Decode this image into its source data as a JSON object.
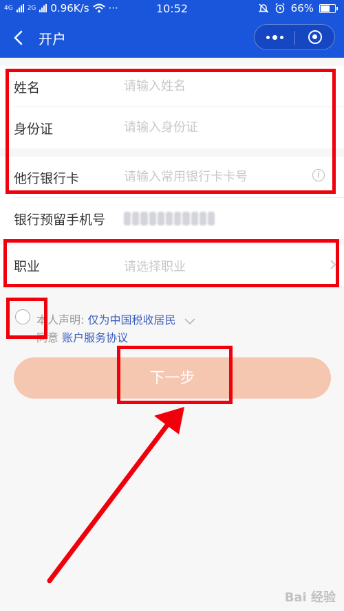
{
  "status_bar": {
    "network_speed": "0.96K/s",
    "time": "10:52",
    "battery_percent": "66%",
    "signal_labels": [
      "4G",
      "2G"
    ],
    "more_indicator": "···"
  },
  "nav": {
    "title": "开户"
  },
  "form": {
    "name": {
      "label": "姓名",
      "placeholder": "请输入姓名"
    },
    "id_card": {
      "label": "身份证",
      "placeholder": "请输入身份证"
    },
    "bank_card": {
      "label": "他行银行卡",
      "placeholder": "请输入常用银行卡卡号"
    },
    "phone": {
      "label": "银行预留手机号"
    },
    "occupation": {
      "label": "职业",
      "placeholder": "请选择职业"
    }
  },
  "agreement": {
    "declaration_prefix": "本人声明:",
    "declaration_value": "仅为中国税收居民",
    "agree_prefix": "同意",
    "agree_link": "账户服务协议"
  },
  "next_button": {
    "label": "下一步"
  },
  "watermark": "Bai 经验",
  "colors": {
    "header_blue": "#1a56db",
    "button_disabled": "#f5c6b0",
    "link_blue": "#3b5fc0",
    "annotation_red": "#f0000a"
  }
}
